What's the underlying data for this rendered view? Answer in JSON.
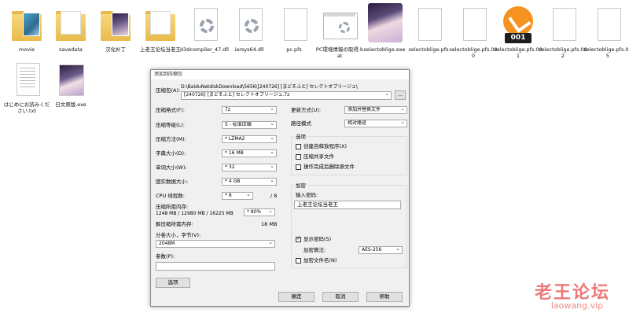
{
  "desktop": {
    "icons": [
      {
        "label": "movie"
      },
      {
        "label": "savedata"
      },
      {
        "label": "汉化补丁"
      },
      {
        "label": "上老王论坛当老王"
      },
      {
        "label": "d3dcompiler_47.dll"
      },
      {
        "label": "iarsys64.dll"
      },
      {
        "label": "pc.pfs"
      },
      {
        "label": "PC環境情報の取得.bat"
      },
      {
        "label": "selectoblige.exe"
      },
      {
        "label": "selectoblige.pfs"
      },
      {
        "label": "selectoblige.pfs.000"
      },
      {
        "label": "selectoblige.pfs.001"
      },
      {
        "label": "selectoblige.pfs.002"
      },
      {
        "label": "selectoblige.pfs.005"
      },
      {
        "label": "はじめにお読みください.txt"
      },
      {
        "label": "日文原版.exe"
      }
    ],
    "badge_text": "001"
  },
  "dialog": {
    "title": "添加到压缩包",
    "archive_label": "压缩包(A):",
    "archive_path": "D:\\BaiduNetdiskDownload\\5656\\[240726] [まどそふと] セレクトオブリージュ\\",
    "archive_name": "[240726] [まどそふと] セレクトオブリージュ.7z",
    "browse_label": "...",
    "left": [
      {
        "label": "压缩格式(F):",
        "value": "7z"
      },
      {
        "label": "压缩等级(L):",
        "value": "5 - 标准压缩"
      },
      {
        "label": "压缩方法(M):",
        "value": "* LZMA2"
      },
      {
        "label": "字典大小(D):",
        "value": "* 16 MB"
      },
      {
        "label": "单词大小(W):",
        "value": "* 32"
      },
      {
        "label": "固实数据大小:",
        "value": "* 4 GB"
      }
    ],
    "cpu_label": "CPU 线程数:",
    "cpu_value": "* 8",
    "cpu_max": "/ 8",
    "mem_label": "压缩所需内存:",
    "mem_detail": "1248 MB / 12980 MB / 16225 MB",
    "mem_value": "* 80%",
    "decomp_label": "解压缩所需内存:",
    "decomp_value": "18 MB",
    "split_label": "分卷大小，字节(V):",
    "split_value": "2048M",
    "params_label": "参数(P):",
    "params_value": "",
    "options_button": "选项",
    "update_label": "更新方式(U):",
    "update_value": "添加并替换文件",
    "path_label": "路径模式",
    "path_value": "相对路径",
    "options_group": "选项",
    "opt_sfx": "创建自释放程序(X)",
    "opt_shared": "压缩共享文件",
    "opt_delete": "操作完成后删除源文件",
    "encrypt_group": "加密",
    "password_label": "输入密码:",
    "password_value": "上老王论坛当老王",
    "show_password": "显示密码(S)",
    "encrypt_method_label": "加密算法:",
    "encrypt_method_value": "AES-256",
    "encrypt_names": "加密文件名(N)",
    "ok": "确定",
    "cancel": "取消",
    "help": "帮助"
  },
  "watermark": {
    "text": "老王论坛",
    "url": "laowang.vip"
  },
  "colors": {
    "folder": "#f0c75e",
    "badge_orange": "#f49320",
    "watermark": "#e64646"
  }
}
